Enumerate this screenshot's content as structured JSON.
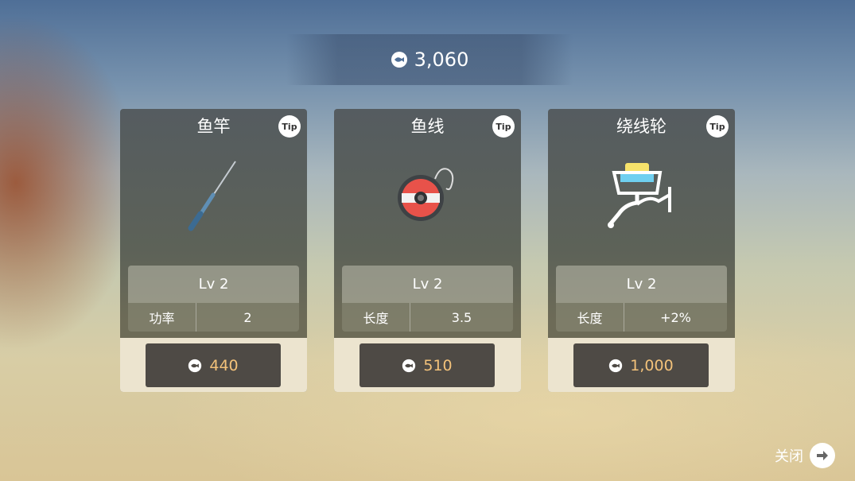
{
  "currency": {
    "total": "3,060",
    "icon": "fish-coin-icon"
  },
  "cards": [
    {
      "title": "鱼竿",
      "tip": "Tip",
      "icon": "fishing-rod-icon",
      "level": "Lv 2",
      "stat_label": "功率",
      "stat_value": "2",
      "price": "440"
    },
    {
      "title": "鱼线",
      "tip": "Tip",
      "icon": "fishing-line-spool-icon",
      "level": "Lv 2",
      "stat_label": "长度",
      "stat_value": "3.5",
      "price": "510"
    },
    {
      "title": "绕线轮",
      "tip": "Tip",
      "icon": "fishing-reel-icon",
      "level": "Lv 2",
      "stat_label": "长度",
      "stat_value": "+2%",
      "price": "1,000"
    }
  ],
  "close": {
    "label": "关闭",
    "icon": "arrow-right-icon"
  },
  "colors": {
    "price": "#f3c27a",
    "button": "#4e4a45",
    "card_bottom": "#ece4cf"
  }
}
